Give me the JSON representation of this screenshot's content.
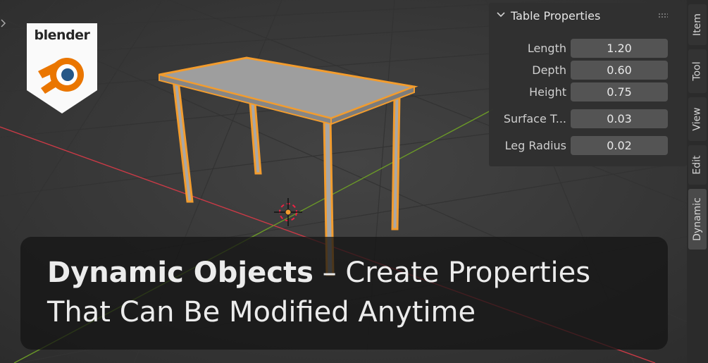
{
  "logo": {
    "text": "blender"
  },
  "panel": {
    "title": "Table Properties",
    "properties": [
      {
        "label": "Length",
        "value": "1.20"
      },
      {
        "label": "Depth",
        "value": "0.60"
      },
      {
        "label": "Height",
        "value": "0.75"
      },
      {
        "label": "Surface T...",
        "value": "0.03"
      },
      {
        "label": "Leg Radius",
        "value": "0.02"
      }
    ]
  },
  "tabs": [
    {
      "label": "Item",
      "active": false
    },
    {
      "label": "Tool",
      "active": false
    },
    {
      "label": "View",
      "active": false
    },
    {
      "label": "Edit",
      "active": false
    },
    {
      "label": "Dynamic",
      "active": true
    }
  ],
  "banner": {
    "line1_bold": "Dynamic Objects",
    "line1_rest": " – Create Properties",
    "line2": "That Can Be Modified Anytime"
  },
  "colors": {
    "selection_outline": "#f29c2e",
    "x_axis": "#c93a46",
    "y_axis": "#6b9a27",
    "viewport_bg": "#3d3d3d",
    "logo_orange": "#ea7600",
    "logo_blue": "#265787"
  },
  "icons": [
    "blender-logo-icon",
    "chevron-down-icon",
    "grip-icon",
    "3d-cursor-icon",
    "expand-arrow-icon"
  ]
}
